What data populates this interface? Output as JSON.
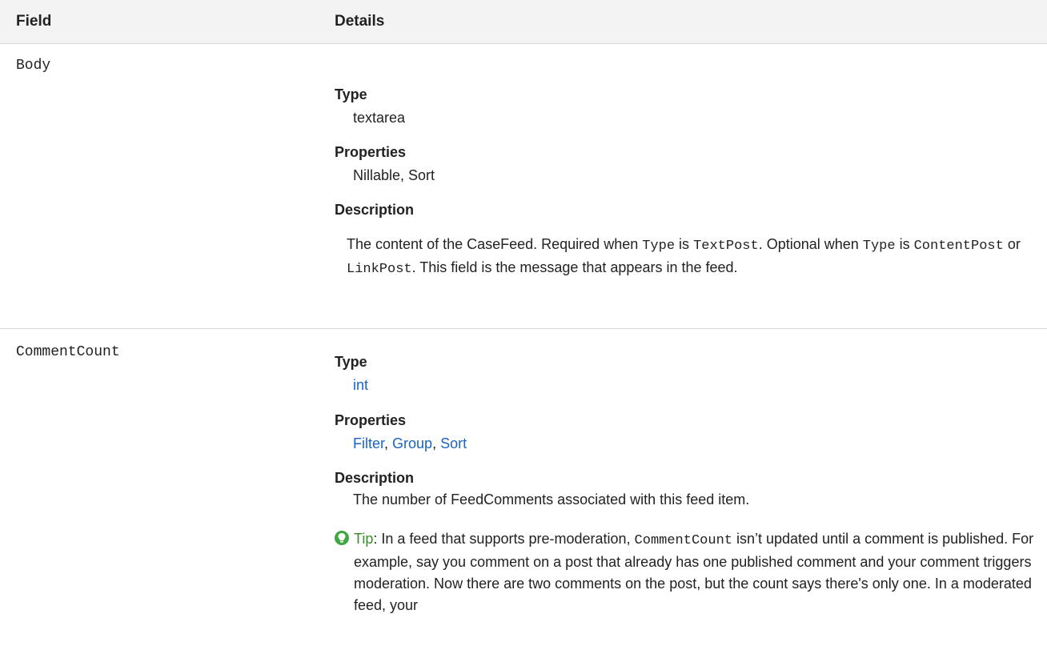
{
  "header": {
    "field_label": "Field",
    "details_label": "Details"
  },
  "rows": [
    {
      "field": "Body",
      "type_label": "Type",
      "type_value": "textarea",
      "properties_label": "Properties",
      "properties_value": "Nillable, Sort",
      "description_label": "Description",
      "description": {
        "t1": "The content of the CaseFeed. Required when ",
        "c1": "Type",
        "t2": " is ",
        "c2": "TextPost",
        "t3": ". Optional when ",
        "c3": "Type",
        "t4": " is ",
        "c4": "ContentPost",
        "t5": " or ",
        "c5": "LinkPost",
        "t6": ". This field is the message that appears in the feed."
      }
    },
    {
      "field": "CommentCount",
      "type_label": "Type",
      "type_value": "int",
      "properties_label": "Properties",
      "properties": [
        "Filter",
        "Group",
        "Sort"
      ],
      "description_label": "Description",
      "description_text": "The number of FeedComments associated with this feed item.",
      "tip": {
        "label": "Tip",
        "t1": ":  In a feed that supports pre-moderation, ",
        "c1": "CommentCount",
        "t2": " isn’t updated until a comment is published. For example, say you comment on a post that already has one published comment and your comment triggers moderation. Now there are two comments on the post, but the count says there's only one. In a moderated feed, your"
      }
    }
  ],
  "colors": {
    "link": "#1a64c5",
    "tip_label": "#3a8c2a",
    "tip_icon": "#3fa640",
    "header_bg": "#f3f3f3"
  },
  "icons": {
    "tip": "lightbulb-icon"
  }
}
